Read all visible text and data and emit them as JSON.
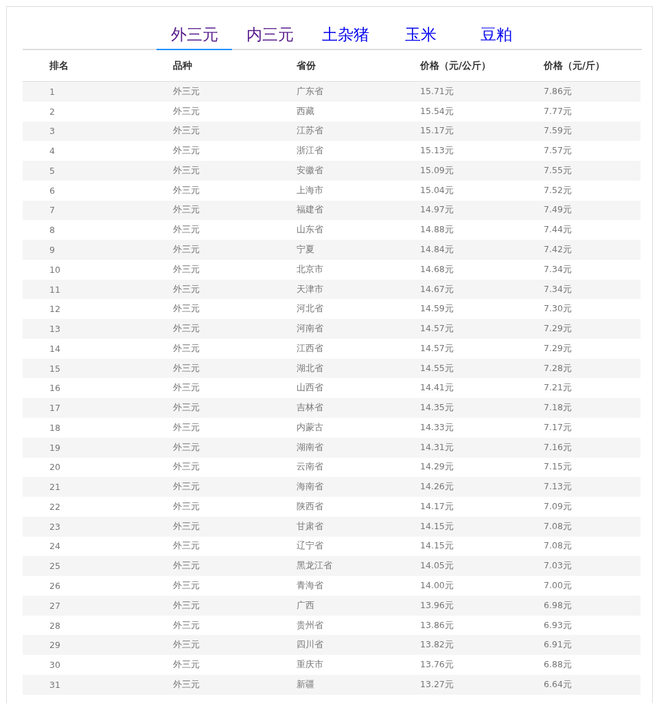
{
  "tabs": [
    {
      "label": "外三元",
      "selected": true,
      "visited": true
    },
    {
      "label": "内三元",
      "selected": false,
      "visited": true
    },
    {
      "label": "土杂猪",
      "selected": false,
      "visited": false
    },
    {
      "label": "玉米",
      "selected": false,
      "visited": false
    },
    {
      "label": "豆粕",
      "selected": false,
      "visited": false
    }
  ],
  "table": {
    "columns": [
      "排名",
      "品种",
      "省份",
      "价格（元/公斤）",
      "价格（元/斤）"
    ],
    "rows": [
      [
        "1",
        "外三元",
        "广东省",
        "15.71元",
        "7.86元"
      ],
      [
        "2",
        "外三元",
        "西藏",
        "15.54元",
        "7.77元"
      ],
      [
        "3",
        "外三元",
        "江苏省",
        "15.17元",
        "7.59元"
      ],
      [
        "4",
        "外三元",
        "浙江省",
        "15.13元",
        "7.57元"
      ],
      [
        "5",
        "外三元",
        "安徽省",
        "15.09元",
        "7.55元"
      ],
      [
        "6",
        "外三元",
        "上海市",
        "15.04元",
        "7.52元"
      ],
      [
        "7",
        "外三元",
        "福建省",
        "14.97元",
        "7.49元"
      ],
      [
        "8",
        "外三元",
        "山东省",
        "14.88元",
        "7.44元"
      ],
      [
        "9",
        "外三元",
        "宁夏",
        "14.84元",
        "7.42元"
      ],
      [
        "10",
        "外三元",
        "北京市",
        "14.68元",
        "7.34元"
      ],
      [
        "11",
        "外三元",
        "天津市",
        "14.67元",
        "7.34元"
      ],
      [
        "12",
        "外三元",
        "河北省",
        "14.59元",
        "7.30元"
      ],
      [
        "13",
        "外三元",
        "河南省",
        "14.57元",
        "7.29元"
      ],
      [
        "14",
        "外三元",
        "江西省",
        "14.57元",
        "7.29元"
      ],
      [
        "15",
        "外三元",
        "湖北省",
        "14.55元",
        "7.28元"
      ],
      [
        "16",
        "外三元",
        "山西省",
        "14.41元",
        "7.21元"
      ],
      [
        "17",
        "外三元",
        "吉林省",
        "14.35元",
        "7.18元"
      ],
      [
        "18",
        "外三元",
        "内蒙古",
        "14.33元",
        "7.17元"
      ],
      [
        "19",
        "外三元",
        "湖南省",
        "14.31元",
        "7.16元"
      ],
      [
        "20",
        "外三元",
        "云南省",
        "14.29元",
        "7.15元"
      ],
      [
        "21",
        "外三元",
        "海南省",
        "14.26元",
        "7.13元"
      ],
      [
        "22",
        "外三元",
        "陕西省",
        "14.17元",
        "7.09元"
      ],
      [
        "23",
        "外三元",
        "甘肃省",
        "14.15元",
        "7.08元"
      ],
      [
        "24",
        "外三元",
        "辽宁省",
        "14.15元",
        "7.08元"
      ],
      [
        "25",
        "外三元",
        "黑龙江省",
        "14.05元",
        "7.03元"
      ],
      [
        "26",
        "外三元",
        "青海省",
        "14.00元",
        "7.00元"
      ],
      [
        "27",
        "外三元",
        "广西",
        "13.96元",
        "6.98元"
      ],
      [
        "28",
        "外三元",
        "贵州省",
        "13.86元",
        "6.93元"
      ],
      [
        "29",
        "外三元",
        "四川省",
        "13.82元",
        "6.91元"
      ],
      [
        "30",
        "外三元",
        "重庆市",
        "13.76元",
        "6.88元"
      ],
      [
        "31",
        "外三元",
        "新疆",
        "13.27元",
        "6.64元"
      ]
    ]
  }
}
